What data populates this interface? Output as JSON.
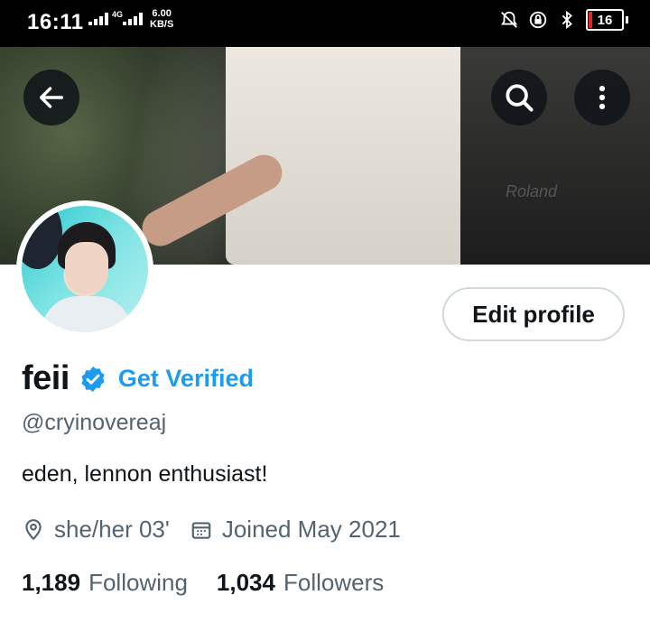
{
  "status_bar": {
    "time": "16:11",
    "network_type": "4G",
    "speed_value": "6.00",
    "speed_unit": "KB/S",
    "battery": "16"
  },
  "header": {
    "back_icon": "arrow-left-icon",
    "search_icon": "search-icon",
    "more_icon": "more-vertical-icon",
    "banner_text": "Roland"
  },
  "profile": {
    "display_name": "feii",
    "verified_badge": "verified-badge-icon",
    "get_verified_label": "Get Verified",
    "handle": "@cryinovereaj",
    "bio": "eden, lennon enthusiast!",
    "location": "she/her 03'",
    "joined": "Joined May 2021",
    "edit_profile_label": "Edit profile",
    "following_count": "1,189",
    "following_label": "Following",
    "followers_count": "1,034",
    "followers_label": "Followers"
  },
  "colors": {
    "accent": "#1d9bf0",
    "secondary_text": "#536471",
    "primary_text": "#0f1419",
    "battery_low": "#e0262c"
  }
}
